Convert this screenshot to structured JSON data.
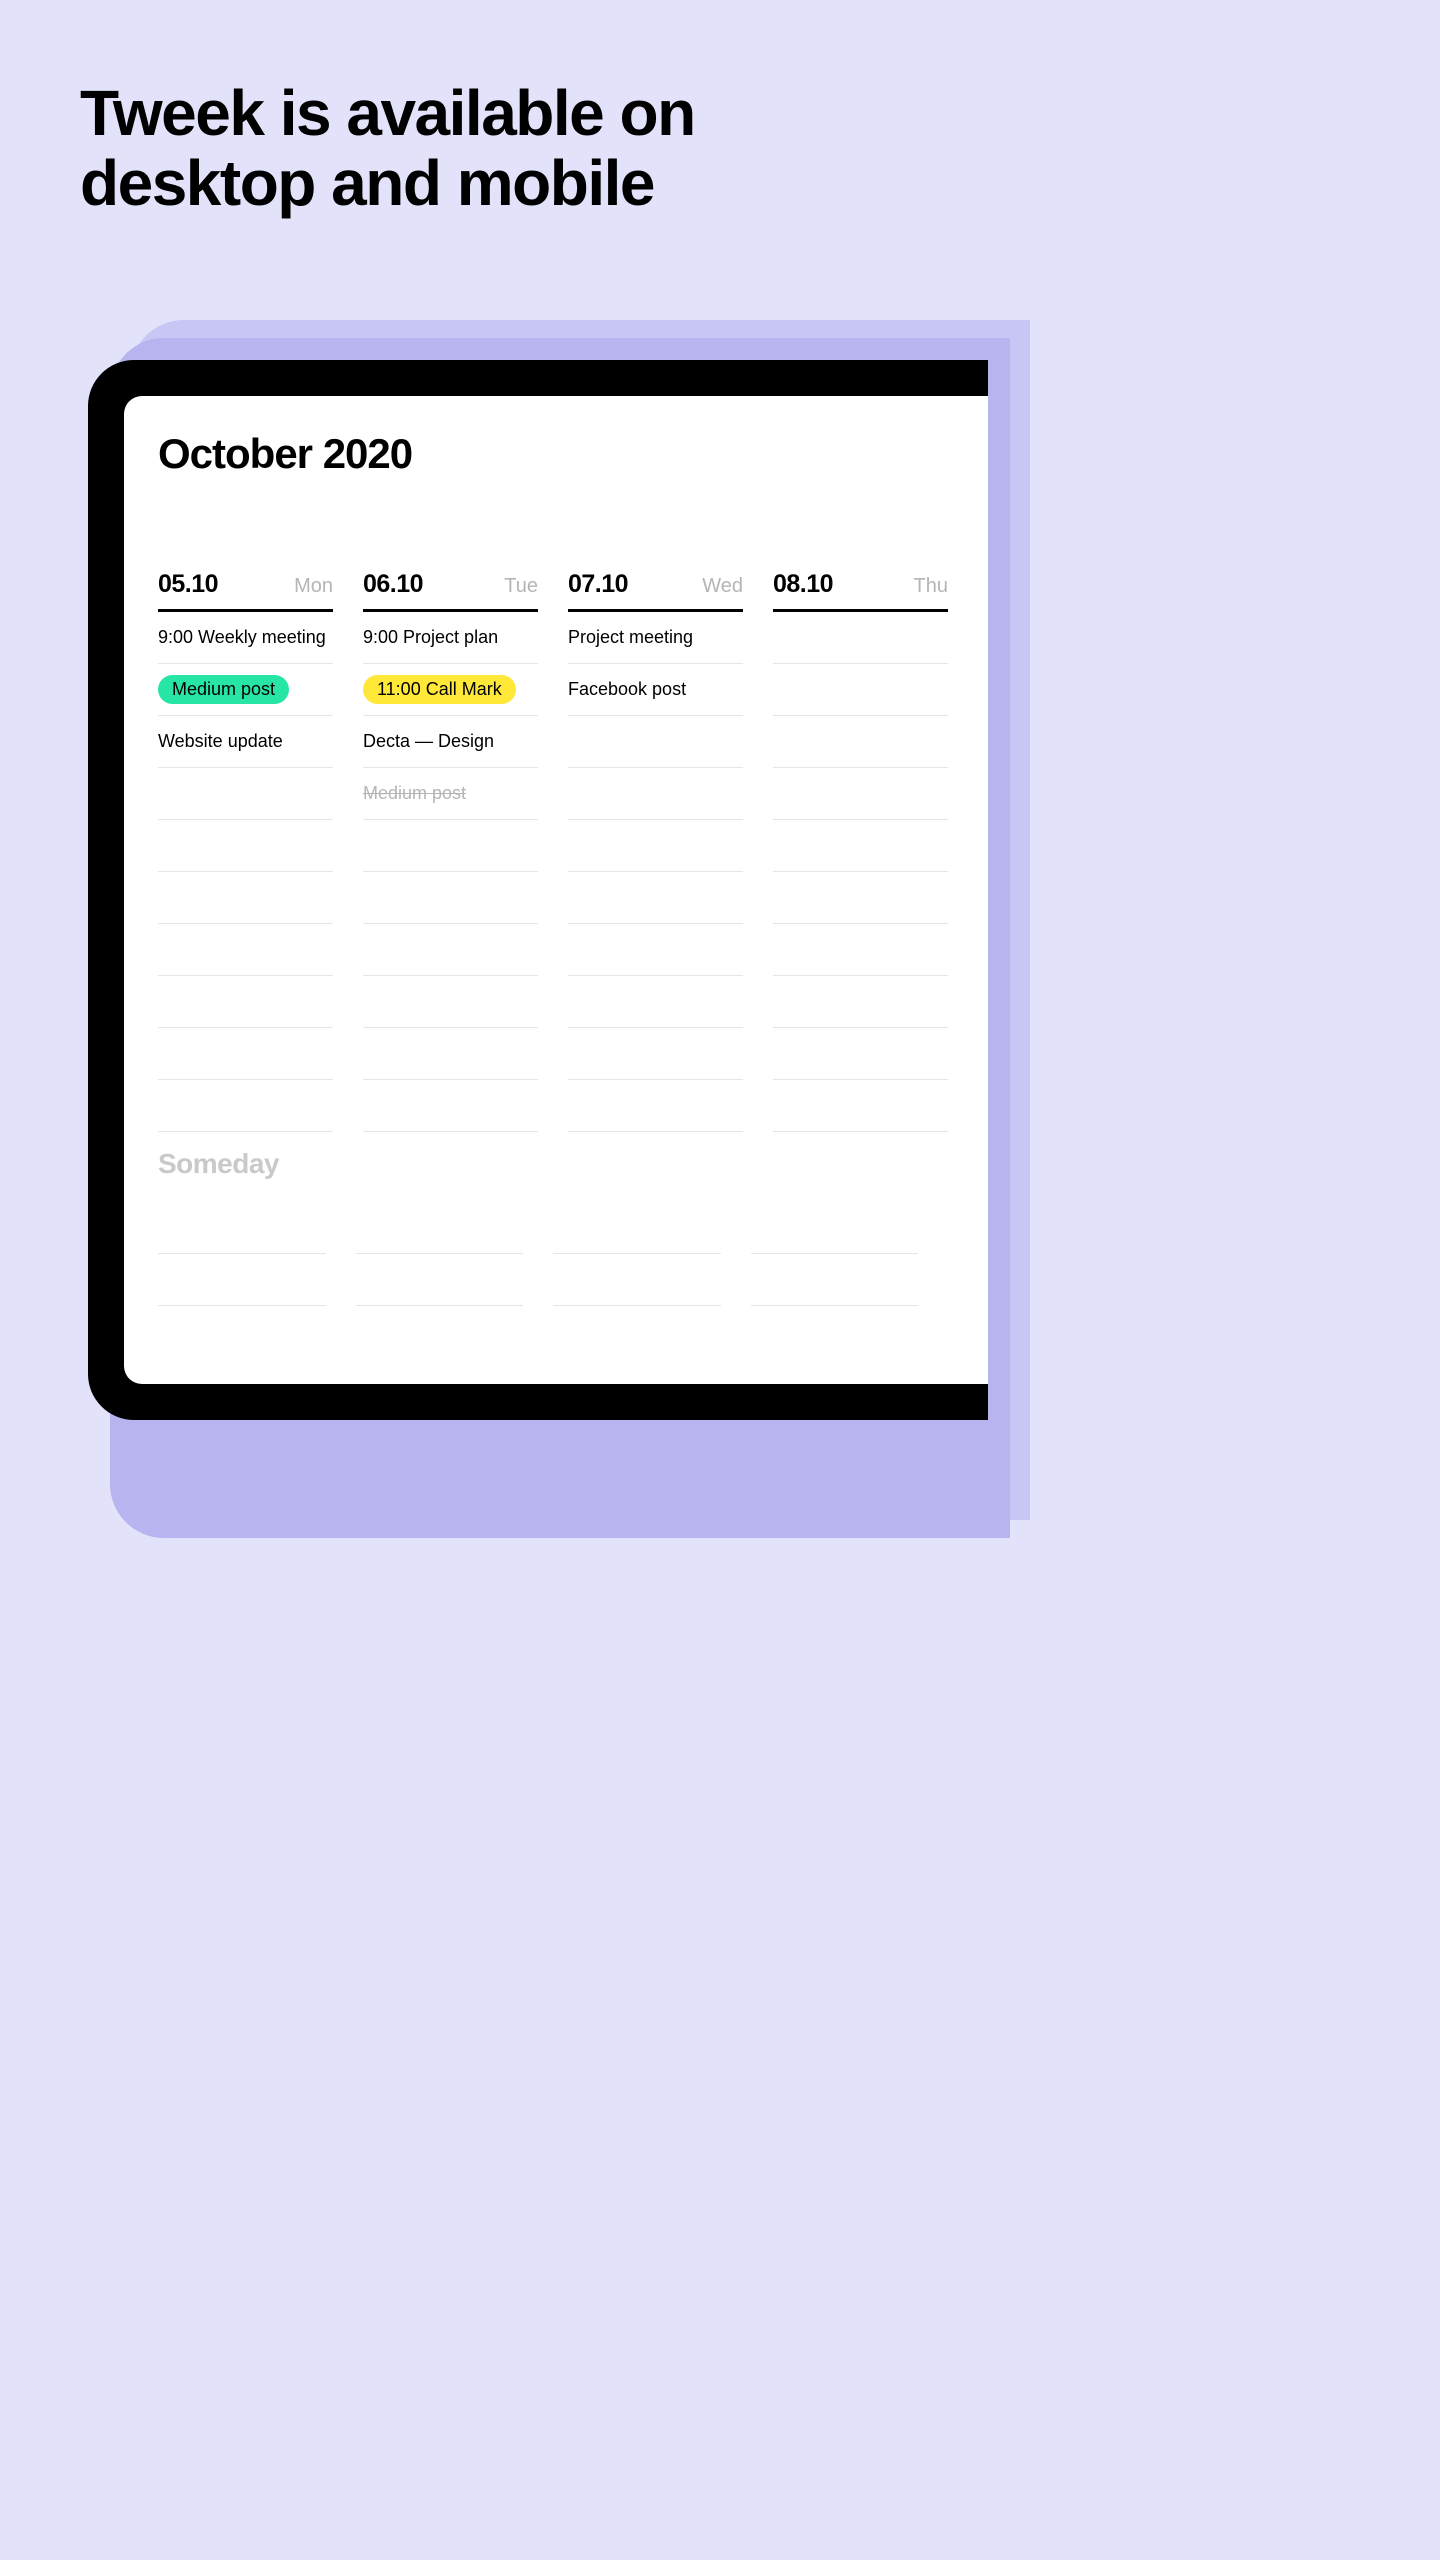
{
  "headline": "Tweek is available on desktop and mobile",
  "calendar": {
    "month_title": "October 2020",
    "empty_rows_per_day": 10,
    "days": [
      {
        "date": "05.10",
        "name": "Mon",
        "tasks": [
          {
            "text": "9:00 Weekly meeting",
            "style": "plain"
          },
          {
            "text": "Medium post",
            "style": "pill-green"
          },
          {
            "text": "Website update",
            "style": "plain"
          }
        ]
      },
      {
        "date": "06.10",
        "name": "Tue",
        "tasks": [
          {
            "text": "9:00 Project plan",
            "style": "plain"
          },
          {
            "text": "11:00 Call Mark",
            "style": "pill-yellow"
          },
          {
            "text": "Decta — Design",
            "style": "plain"
          },
          {
            "text": "Medium post",
            "style": "done"
          }
        ]
      },
      {
        "date": "07.10",
        "name": "Wed",
        "tasks": [
          {
            "text": "Project meeting",
            "style": "plain"
          },
          {
            "text": "Facebook post",
            "style": "plain"
          }
        ]
      },
      {
        "date": "08.10",
        "name": "Thu",
        "tasks": []
      }
    ],
    "someday": {
      "title": "Someday",
      "rows": 2,
      "cols": 4
    }
  },
  "colors": {
    "bg": "#e3e2fb",
    "shadow1": "#c8c6f4",
    "shadow2": "#b7b4ef",
    "pill_green": "#27e6a5",
    "pill_yellow": "#ffe838"
  }
}
